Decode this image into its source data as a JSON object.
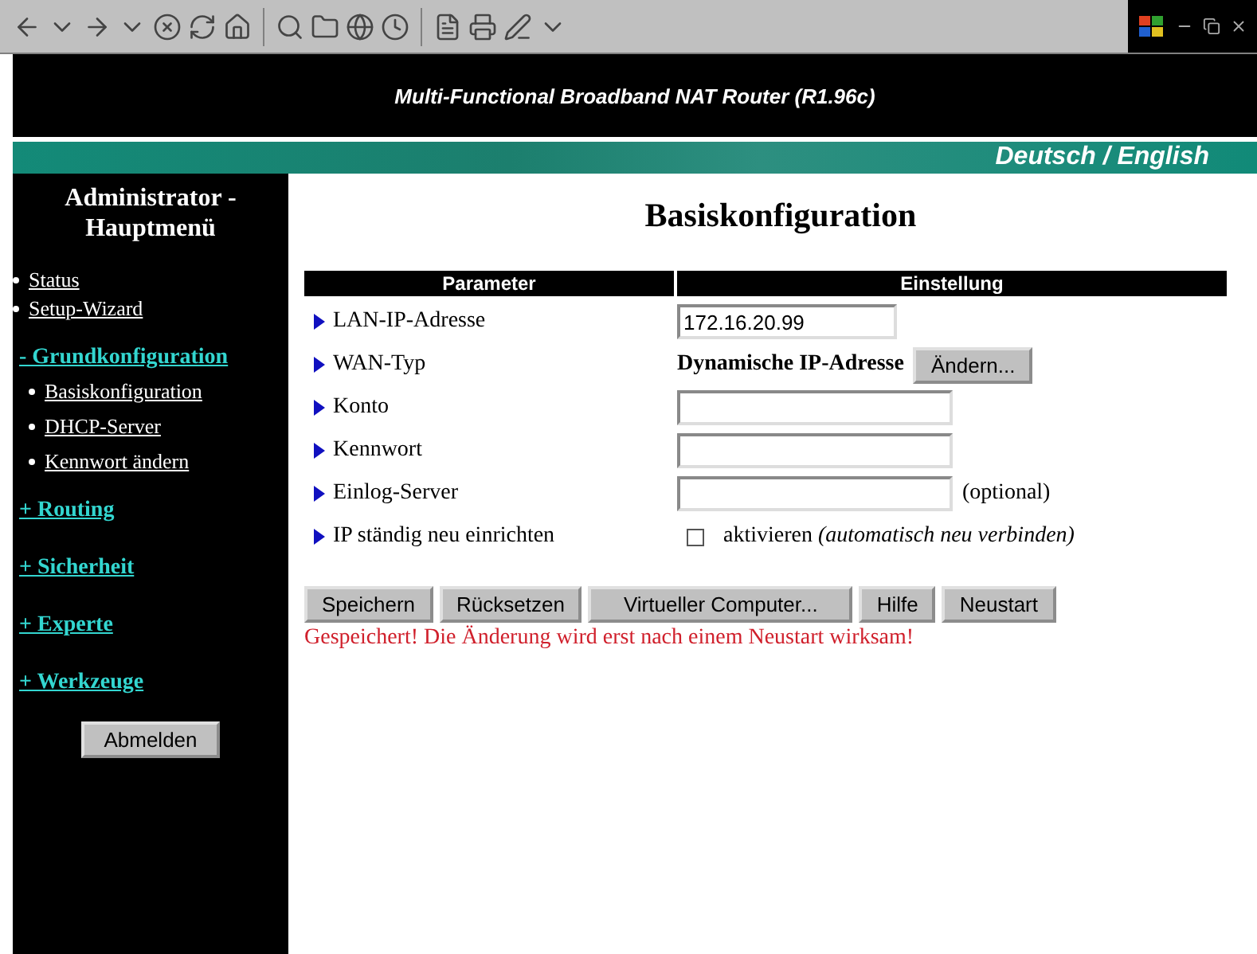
{
  "header": {
    "title": "Multi-Functional Broadband NAT Router (R1.96c)",
    "language_link": "Deutsch / English"
  },
  "sidebar": {
    "title": "Administrator - Hauptmenü",
    "items": [
      {
        "label": "Status",
        "kind": "link"
      },
      {
        "label": "Setup-Wizard",
        "kind": "link"
      },
      {
        "label": "- Grundkonfiguration",
        "kind": "section",
        "children": [
          {
            "label": "Basiskonfiguration"
          },
          {
            "label": "DHCP-Server"
          },
          {
            "label": "Kennwort ändern"
          }
        ]
      },
      {
        "label": "+ Routing",
        "kind": "section"
      },
      {
        "label": "+ Sicherheit",
        "kind": "section"
      },
      {
        "label": "+ Experte",
        "kind": "section"
      },
      {
        "label": "+ Werkzeuge",
        "kind": "section"
      }
    ],
    "logout_button": "Abmelden"
  },
  "page_title": "Basiskonfiguration",
  "table": {
    "columns": [
      "Parameter",
      "Einstellung"
    ],
    "rows": [
      {
        "label": "LAN-IP-Adresse",
        "kind": "input",
        "value": "172.16.20.99"
      },
      {
        "label": "WAN-Typ",
        "kind": "text_button",
        "text": "Dynamische IP-Adresse",
        "button": "Ändern..."
      },
      {
        "label": "Konto",
        "kind": "input"
      },
      {
        "label": "Kennwort",
        "kind": "input"
      },
      {
        "label": "Einlog-Server",
        "kind": "input",
        "suffix": "(optional)"
      },
      {
        "label": "IP ständig neu einrichten",
        "kind": "checkbox",
        "checked": false,
        "text": "aktivieren *(automatisch neu verbinden)*"
      }
    ]
  },
  "buttons": [
    "Speichern",
    "Rücksetzen",
    "Virtueller Computer...",
    "Hilfe",
    "Neustart"
  ],
  "message": "Gespeichert! Die Änderung wird erst nach einem Neustart wirksam!"
}
